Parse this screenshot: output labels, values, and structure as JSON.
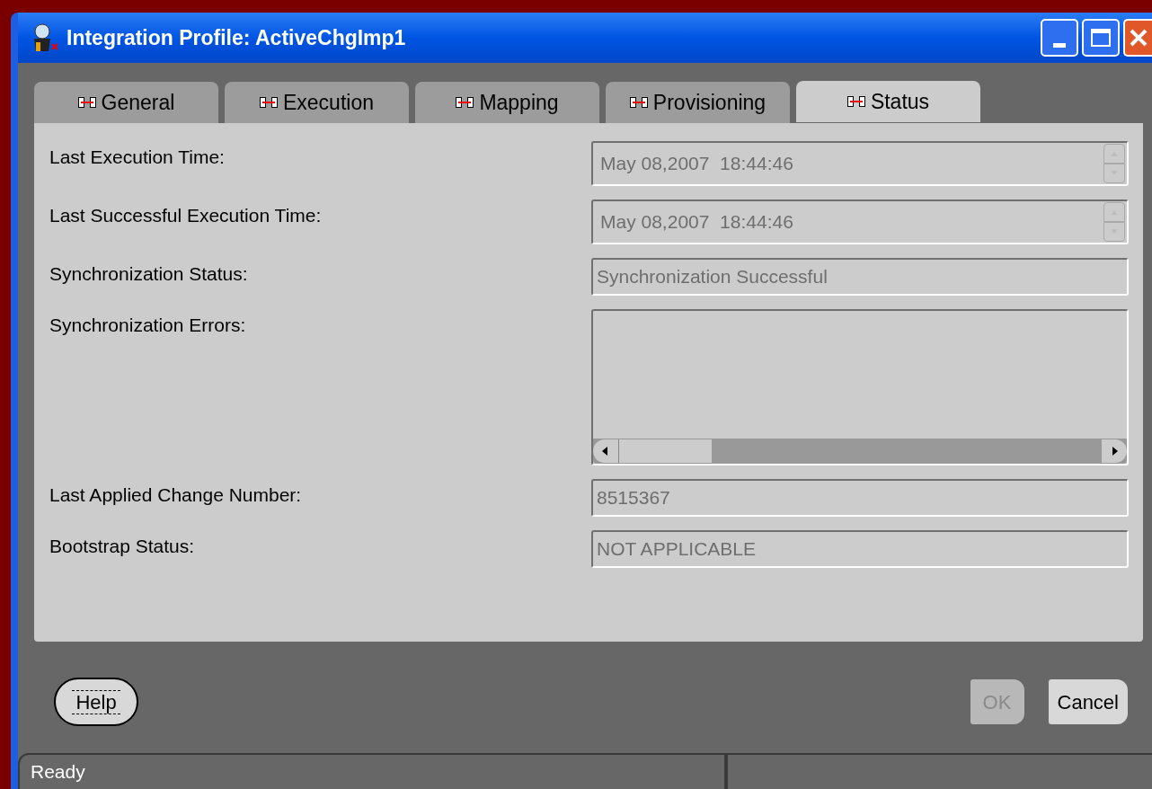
{
  "window": {
    "title": "Integration Profile: ActiveChgImp1"
  },
  "tabs": [
    {
      "label": "General",
      "selected": false
    },
    {
      "label": "Execution",
      "selected": false
    },
    {
      "label": "Mapping",
      "selected": false
    },
    {
      "label": "Provisioning",
      "selected": false
    },
    {
      "label": "Status",
      "selected": true
    }
  ],
  "fields": [
    {
      "label": "Last Execution Time:",
      "kind": "spinner",
      "value": "May 08,2007  18:44:46",
      "disabled": true
    },
    {
      "label": "Last Successful Execution Time:",
      "kind": "spinner",
      "value": "May 08,2007  18:44:46",
      "disabled": true
    },
    {
      "label": "Synchronization Status:",
      "kind": "text",
      "value": "Synchronization Successful",
      "disabled": true
    },
    {
      "label": "Synchronization Errors:",
      "kind": "textarea"
    },
    {
      "label": "Last Applied Change Number:",
      "kind": "text",
      "value": "8515367",
      "disabled": true
    },
    {
      "label": "Bootstrap Status:",
      "kind": "text",
      "value": "NOT APPLICABLE",
      "disabled": true
    }
  ],
  "buttons": [
    {
      "label": "Help",
      "kind": "help",
      "disabled": false
    },
    {
      "label": "OK",
      "kind": "action",
      "disabled": true
    },
    {
      "label": "Cancel",
      "kind": "action",
      "disabled": false
    }
  ],
  "status_bar": {
    "text": "Ready"
  }
}
